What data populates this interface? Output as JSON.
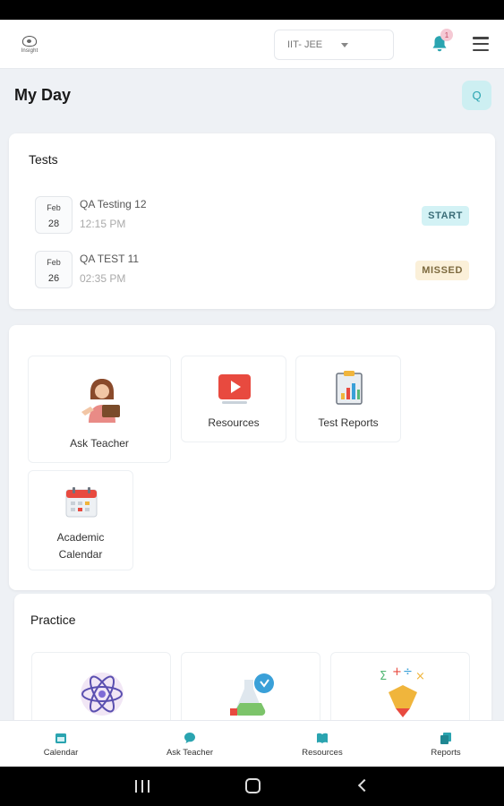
{
  "header": {
    "logo_text": "Insight",
    "course_select": {
      "value": "IIT- JEE"
    },
    "notification_count": "1"
  },
  "page": {
    "title": "My Day",
    "quick_button_label": "Q"
  },
  "tests": {
    "title": "Tests",
    "items": [
      {
        "month": "Feb",
        "day": "28",
        "name": "QA Testing 12",
        "time": "12:15 PM",
        "status": "START"
      },
      {
        "month": "Feb",
        "day": "26",
        "name": "QA TEST 11",
        "time": "02:35 PM",
        "status": "MISSED"
      }
    ]
  },
  "tiles": {
    "ask_teacher": "Ask Teacher",
    "resources": "Resources",
    "test_reports": "Test Reports",
    "academic_calendar_line1": "Academic",
    "academic_calendar_line2": "Calendar"
  },
  "practice": {
    "title": "Practice"
  },
  "bottom_nav": {
    "calendar": "Calendar",
    "ask_teacher": "Ask Teacher",
    "resources": "Resources",
    "reports": "Reports"
  },
  "colors": {
    "accent": "#2aa4b0",
    "start_badge_bg": "#d3f2f5",
    "missed_badge_bg": "#fbf0d9",
    "background": "#eef1f5"
  }
}
